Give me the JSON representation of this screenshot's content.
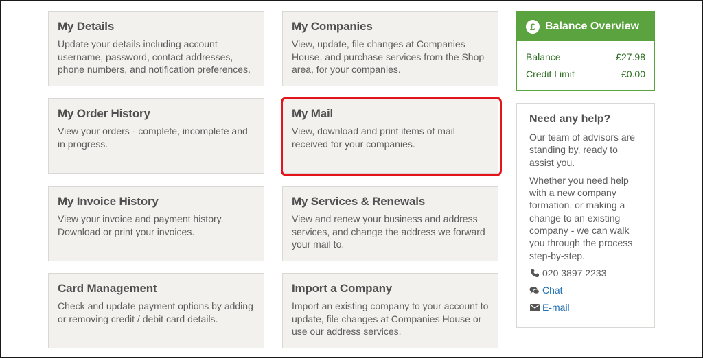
{
  "cards": [
    {
      "title": "My Details",
      "desc": "Update your details including account username, password, contact addresses, phone numbers, and notification preferences."
    },
    {
      "title": "My Companies",
      "desc": "View, update, file changes at Companies House, and purchase services from the Shop area, for your companies."
    },
    {
      "title": "My Order History",
      "desc": "View your orders - complete, incomplete and in progress."
    },
    {
      "title": "My Mail",
      "desc": "View, download and print items of mail received for your companies."
    },
    {
      "title": "My Invoice History",
      "desc": "View your invoice and payment history. Download or print your invoices."
    },
    {
      "title": "My Services & Renewals",
      "desc": "View and renew your business and address services, and change the address we forward your mail to."
    },
    {
      "title": "Card Management",
      "desc": "Check and update payment options by adding or removing credit / debit card details."
    },
    {
      "title": "Import a Company",
      "desc": "Import an existing company to your account to update, file changes at Companies House or use our address services."
    }
  ],
  "balance": {
    "title": "Balance Overview",
    "icon_symbol": "£",
    "balance_label": "Balance",
    "balance_value": "£27.98",
    "credit_label": "Credit Limit",
    "credit_value": "£0.00",
    "color": "#5ba33e"
  },
  "help": {
    "title": "Need any help?",
    "para1": "Our team of advisors are standing by, ready to assist you.",
    "para2": "Whether you need help with a new company formation, or making a change to an existing company - we can walk you through the process step-by-step.",
    "phone": "020 3897 2233",
    "chat": "Chat",
    "email": "E-mail"
  },
  "highlight_color": "#e3141a"
}
